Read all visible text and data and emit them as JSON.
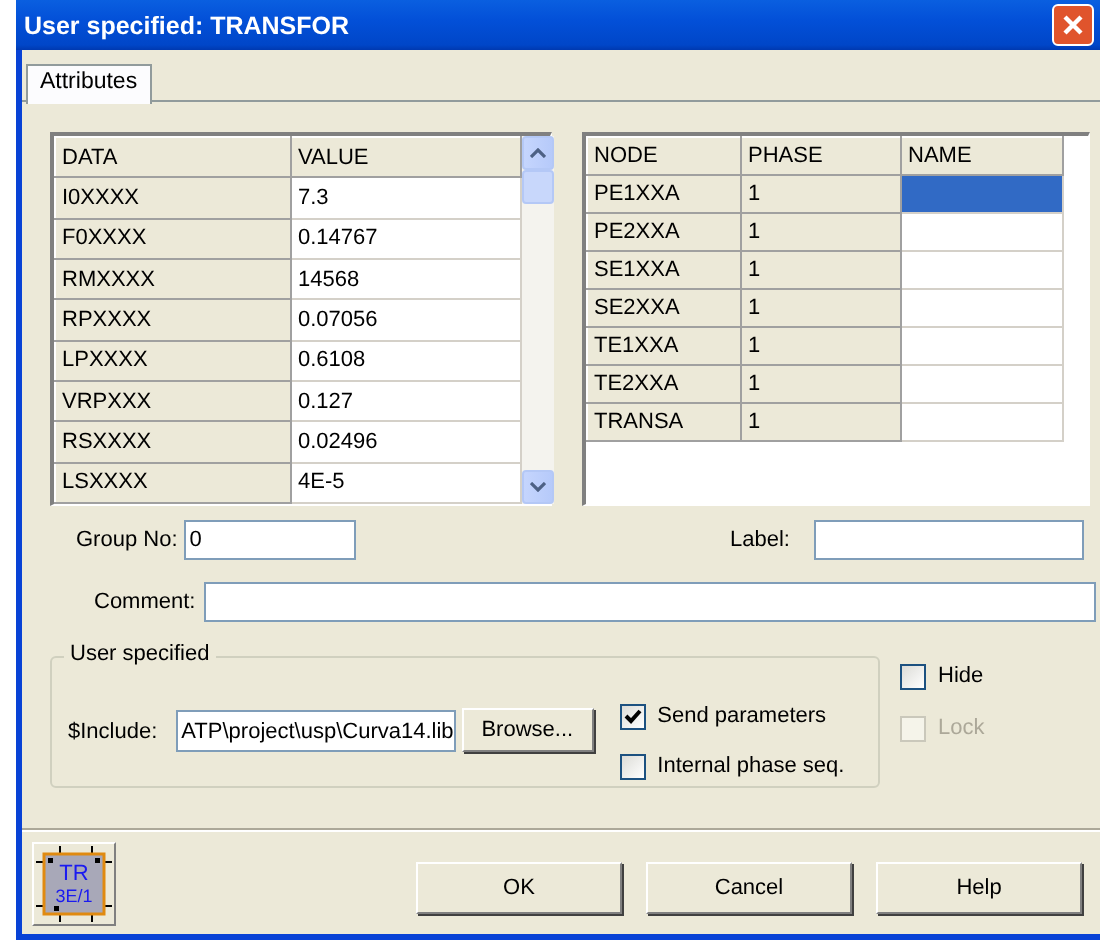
{
  "window": {
    "title": "User specified: TRANSFOR"
  },
  "tabs": [
    {
      "label": "Attributes",
      "selected": true
    }
  ],
  "data_grid": {
    "columns": [
      "DATA",
      "VALUE"
    ],
    "rows": [
      {
        "data": "I0XXXX",
        "value": "7.3"
      },
      {
        "data": "F0XXXX",
        "value": "0.14767"
      },
      {
        "data": "RMXXXX",
        "value": "14568"
      },
      {
        "data": "RPXXXX",
        "value": "0.07056"
      },
      {
        "data": "LPXXXX",
        "value": "0.6108"
      },
      {
        "data": "VRPXXX",
        "value": "0.127"
      },
      {
        "data": "RSXXXX",
        "value": "0.02496"
      },
      {
        "data": "LSXXXX",
        "value": "4E-5"
      }
    ]
  },
  "node_grid": {
    "columns": [
      "NODE",
      "PHASE",
      "NAME"
    ],
    "rows": [
      {
        "node": "PE1XXA",
        "phase": "1",
        "selected": true
      },
      {
        "node": "PE2XXA",
        "phase": "1",
        "selected": false
      },
      {
        "node": "SE1XXA",
        "phase": "1",
        "selected": false
      },
      {
        "node": "SE2XXA",
        "phase": "1",
        "selected": false
      },
      {
        "node": "TE1XXA",
        "phase": "1",
        "selected": false
      },
      {
        "node": "TE2XXA",
        "phase": "1",
        "selected": false
      },
      {
        "node": "TRANSA",
        "phase": "1",
        "selected": false
      }
    ]
  },
  "group_no": {
    "label": "Group No:",
    "value": "0"
  },
  "label_field": {
    "label": "Label:"
  },
  "comment": {
    "label": "Comment:"
  },
  "user_specified": {
    "title": "User specified",
    "include": {
      "label": "$Include:",
      "value": "ATP\\project\\usp\\Curva14.lib"
    },
    "browse": {
      "label": "Browse..."
    },
    "options": [
      {
        "label": "Send parameters",
        "checked": true
      },
      {
        "label": "Internal phase seq.",
        "checked": false
      }
    ]
  },
  "side_options": [
    {
      "label": "Hide",
      "checked": false,
      "disabled": false
    },
    {
      "label": "Lock",
      "checked": false,
      "disabled": true
    }
  ],
  "component_icon": {
    "lines": [
      "TR",
      "3E/1"
    ]
  },
  "buttons": [
    {
      "label": "OK"
    },
    {
      "label": "Cancel"
    },
    {
      "label": "Help"
    }
  ]
}
